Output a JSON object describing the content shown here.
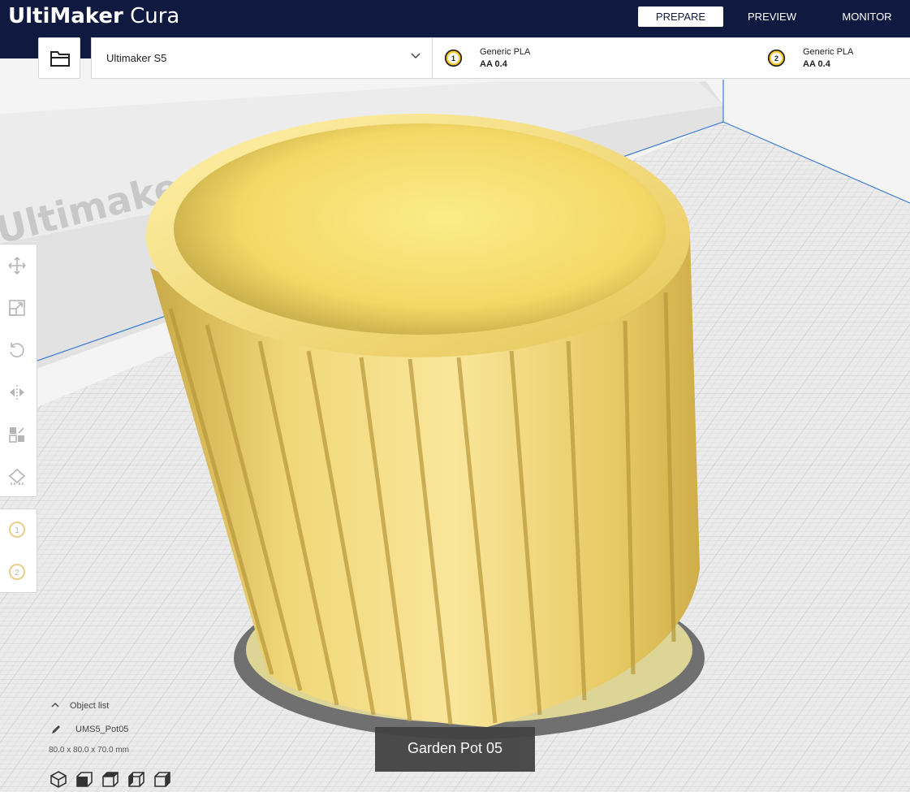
{
  "app": {
    "logo_bold": "UltiMaker",
    "logo_light": "Cura"
  },
  "stages": [
    {
      "label": "PREPARE",
      "active": true
    },
    {
      "label": "PREVIEW",
      "active": false
    },
    {
      "label": "MONITOR",
      "active": false
    }
  ],
  "printer": {
    "name": "Ultimaker S5",
    "watermark": "Ultimaker S5"
  },
  "extruders": [
    {
      "index": "1",
      "material": "Generic PLA",
      "core": "AA 0.4",
      "color": "#ffc924"
    },
    {
      "index": "2",
      "material": "Generic PLA",
      "core": "AA 0.4",
      "color": "#ffc924"
    }
  ],
  "tools": [
    "move-icon",
    "scale-icon",
    "rotate-icon",
    "mirror-icon",
    "per-model-settings-icon",
    "support-blocker-icon"
  ],
  "extruder_tools": [
    {
      "index": "1"
    },
    {
      "index": "2"
    }
  ],
  "object_list": {
    "title": "Object list",
    "item": "UMS5_Pot05",
    "dimensions": "80.0 x 80.0 x 70.0 mm"
  },
  "model": {
    "label": "Garden Pot 05",
    "color": "#f7e57a"
  },
  "view_buttons": [
    "3d-view-icon",
    "front-view-icon",
    "top-view-icon",
    "left-view-icon",
    "right-view-icon"
  ],
  "colors": {
    "topbar": "#10193f",
    "build_plate": "#ebebeb",
    "grid": "#c8c8c8",
    "model": "#f5dc6a"
  }
}
